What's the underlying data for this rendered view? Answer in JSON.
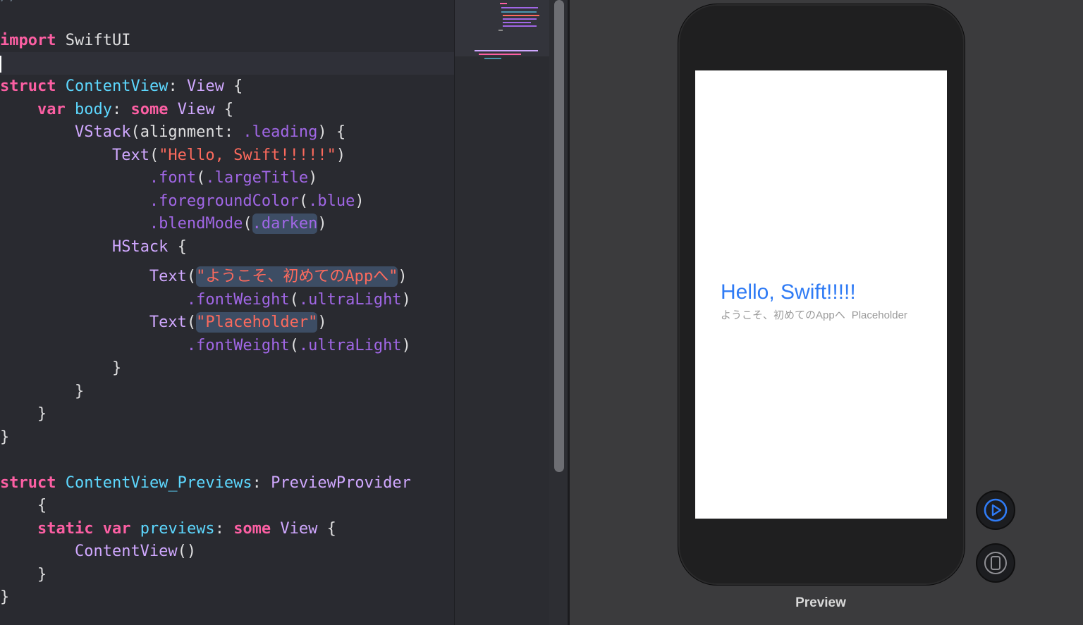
{
  "editor": {
    "top_fragment": "//",
    "lines": [
      {
        "tokens": [
          {
            "t": "import",
            "c": "kw"
          },
          {
            "t": " SwiftUI",
            "c": "pln"
          }
        ]
      },
      {
        "tokens": []
      },
      {
        "tokens": [
          {
            "t": "struct",
            "c": "kw"
          },
          {
            "t": " ",
            "c": "pln"
          },
          {
            "t": "ContentView",
            "c": "typ"
          },
          {
            "t": ": ",
            "c": "pln"
          },
          {
            "t": "View",
            "c": "cls"
          },
          {
            "t": " {",
            "c": "pln"
          }
        ]
      },
      {
        "tokens": [
          {
            "t": "    ",
            "c": "pln"
          },
          {
            "t": "var",
            "c": "kw"
          },
          {
            "t": " ",
            "c": "pln"
          },
          {
            "t": "body",
            "c": "typ"
          },
          {
            "t": ": ",
            "c": "pln"
          },
          {
            "t": "some",
            "c": "kw"
          },
          {
            "t": " ",
            "c": "pln"
          },
          {
            "t": "View",
            "c": "cls"
          },
          {
            "t": " {",
            "c": "pln"
          }
        ]
      },
      {
        "tokens": [
          {
            "t": "        ",
            "c": "pln"
          },
          {
            "t": "VStack",
            "c": "cls"
          },
          {
            "t": "(alignment: ",
            "c": "pln"
          },
          {
            "t": ".leading",
            "c": "mem"
          },
          {
            "t": ") {",
            "c": "pln"
          }
        ]
      },
      {
        "tokens": [
          {
            "t": "            ",
            "c": "pln"
          },
          {
            "t": "Text",
            "c": "cls"
          },
          {
            "t": "(",
            "c": "pln"
          },
          {
            "t": "\"Hello, Swift!!!!!\"",
            "c": "str"
          },
          {
            "t": ")",
            "c": "pln"
          }
        ]
      },
      {
        "tokens": [
          {
            "t": "                ",
            "c": "pln"
          },
          {
            "t": ".font",
            "c": "mem"
          },
          {
            "t": "(",
            "c": "pln"
          },
          {
            "t": ".largeTitle",
            "c": "mem"
          },
          {
            "t": ")",
            "c": "pln"
          }
        ]
      },
      {
        "tokens": [
          {
            "t": "                ",
            "c": "pln"
          },
          {
            "t": ".foregroundColor",
            "c": "mem"
          },
          {
            "t": "(",
            "c": "pln"
          },
          {
            "t": ".blue",
            "c": "mem"
          },
          {
            "t": ")",
            "c": "pln"
          }
        ]
      },
      {
        "tokens": [
          {
            "t": "                ",
            "c": "pln"
          },
          {
            "t": ".blendMode",
            "c": "mem"
          },
          {
            "t": "(",
            "c": "pln"
          },
          {
            "t": ".darken",
            "c": "mem",
            "hl": true
          },
          {
            "t": ")",
            "c": "pln"
          }
        ]
      },
      {
        "tokens": [
          {
            "t": "            ",
            "c": "pln"
          },
          {
            "t": "HStack",
            "c": "cls"
          },
          {
            "t": " {",
            "c": "pln"
          }
        ]
      },
      {
        "tokens": [
          {
            "t": "                ",
            "c": "pln"
          },
          {
            "t": "Text",
            "c": "cls"
          },
          {
            "t": "(",
            "c": "pln"
          },
          {
            "t": "\"ようこそ、初めてのAppへ\"",
            "c": "str",
            "hl": true
          },
          {
            "t": ")",
            "c": "pln"
          }
        ]
      },
      {
        "tokens": [
          {
            "t": "                    ",
            "c": "pln"
          },
          {
            "t": ".fontWeight",
            "c": "mem"
          },
          {
            "t": "(",
            "c": "pln"
          },
          {
            "t": ".ultraLight",
            "c": "mem"
          },
          {
            "t": ")",
            "c": "pln"
          }
        ]
      },
      {
        "tokens": [
          {
            "t": "                ",
            "c": "pln"
          },
          {
            "t": "Text",
            "c": "cls"
          },
          {
            "t": "(",
            "c": "pln"
          },
          {
            "t": "\"Placeholder\"",
            "c": "str",
            "hl": true
          },
          {
            "t": ")",
            "c": "pln"
          }
        ]
      },
      {
        "tokens": [
          {
            "t": "                    ",
            "c": "pln"
          },
          {
            "t": ".fontWeight",
            "c": "mem"
          },
          {
            "t": "(",
            "c": "pln"
          },
          {
            "t": ".ultraLight",
            "c": "mem"
          },
          {
            "t": ")",
            "c": "pln"
          }
        ]
      },
      {
        "tokens": [
          {
            "t": "            }",
            "c": "pln"
          }
        ]
      },
      {
        "tokens": [
          {
            "t": "        }",
            "c": "pln"
          }
        ]
      },
      {
        "tokens": [
          {
            "t": "    }",
            "c": "pln"
          }
        ]
      },
      {
        "tokens": [
          {
            "t": "}",
            "c": "pln"
          }
        ]
      },
      {
        "tokens": []
      },
      {
        "tokens": [
          {
            "t": "struct",
            "c": "kw"
          },
          {
            "t": " ",
            "c": "pln"
          },
          {
            "t": "ContentView_Previews",
            "c": "typ"
          },
          {
            "t": ": ",
            "c": "pln"
          },
          {
            "t": "PreviewProvider",
            "c": "cls"
          }
        ]
      },
      {
        "tokens": [
          {
            "t": "    {",
            "c": "pln"
          }
        ]
      },
      {
        "tokens": [
          {
            "t": "    ",
            "c": "pln"
          },
          {
            "t": "static",
            "c": "kw"
          },
          {
            "t": " ",
            "c": "pln"
          },
          {
            "t": "var",
            "c": "kw"
          },
          {
            "t": " ",
            "c": "pln"
          },
          {
            "t": "previews",
            "c": "typ"
          },
          {
            "t": ": ",
            "c": "pln"
          },
          {
            "t": "some",
            "c": "kw"
          },
          {
            "t": " ",
            "c": "pln"
          },
          {
            "t": "View",
            "c": "cls"
          },
          {
            "t": " {",
            "c": "pln"
          }
        ]
      },
      {
        "tokens": [
          {
            "t": "        ",
            "c": "pln"
          },
          {
            "t": "ContentView",
            "c": "cls"
          },
          {
            "t": "()",
            "c": "pln"
          }
        ]
      },
      {
        "tokens": [
          {
            "t": "    }",
            "c": "pln"
          }
        ]
      },
      {
        "tokens": [
          {
            "t": "}",
            "c": "pln"
          }
        ]
      }
    ]
  },
  "preview": {
    "title": "Hello, Swift!!!!!",
    "subtitle_1": "ようこそ、初めてのAppへ",
    "subtitle_2": "Placeholder",
    "label": "Preview",
    "title_color": "#2f7bf5",
    "live_icon": "play-circle-icon",
    "device_icon": "device-icon",
    "accent_color": "#2f7bf5"
  }
}
